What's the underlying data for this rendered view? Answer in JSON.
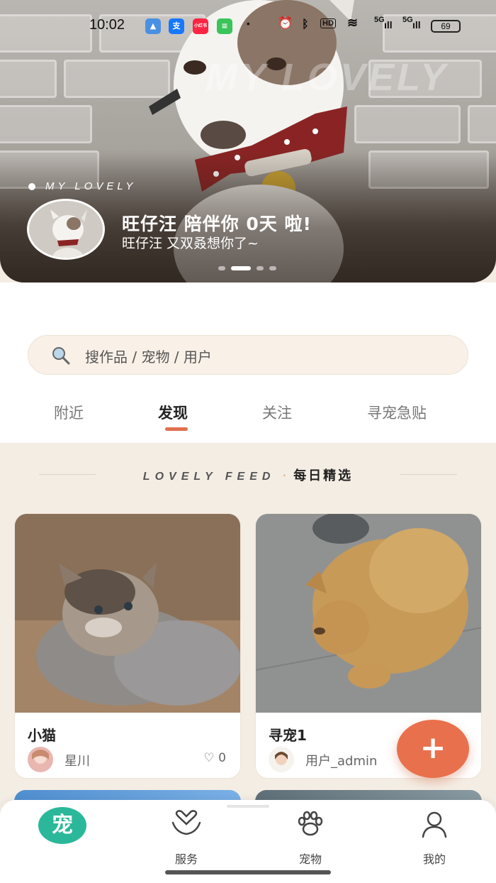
{
  "status_bar": {
    "time": "10:02",
    "apps": [
      "支",
      "小红书"
    ],
    "hd": "HD",
    "signal_1": "5G",
    "signal_2": "5G",
    "battery": "69"
  },
  "banner": {
    "watermark": "MY LOVELY",
    "tag": "MY LOVELY",
    "title": "旺仔汪 陪伴你 0天 啦!",
    "subtitle": "旺仔汪 又双叒想你了~",
    "page_indicator": {
      "count": 4,
      "active": 1
    }
  },
  "search": {
    "placeholder": "搜作品 / 宠物 / 用户",
    "icon": "search-icon"
  },
  "tabs": [
    {
      "label": "附近",
      "active": false
    },
    {
      "label": "发现",
      "active": true
    },
    {
      "label": "关注",
      "active": false
    },
    {
      "label": "寻宠急贴",
      "active": false
    }
  ],
  "feed": {
    "label_en": "LOVELY FEED",
    "separator": "·",
    "label_cn": "每日精选"
  },
  "cards": [
    {
      "title": "小猫",
      "user": "星川",
      "likes": "0",
      "like_icon": "heart-outline-icon"
    },
    {
      "title": "寻宠1",
      "user": "用户_admin"
    }
  ],
  "fab": {
    "label": "+"
  },
  "nav": {
    "items": [
      {
        "label": "",
        "icon": "home-logo-icon",
        "active": true
      },
      {
        "label": "服务",
        "icon": "heart-hands-icon"
      },
      {
        "label": "宠物",
        "icon": "paw-icon"
      },
      {
        "label": "我的",
        "icon": "person-icon"
      }
    ]
  },
  "colors": {
    "accent": "#e8704c",
    "home_active": "#2bb89a",
    "page_bg": "#f4ede4",
    "search_bg": "#f9f1e8"
  }
}
